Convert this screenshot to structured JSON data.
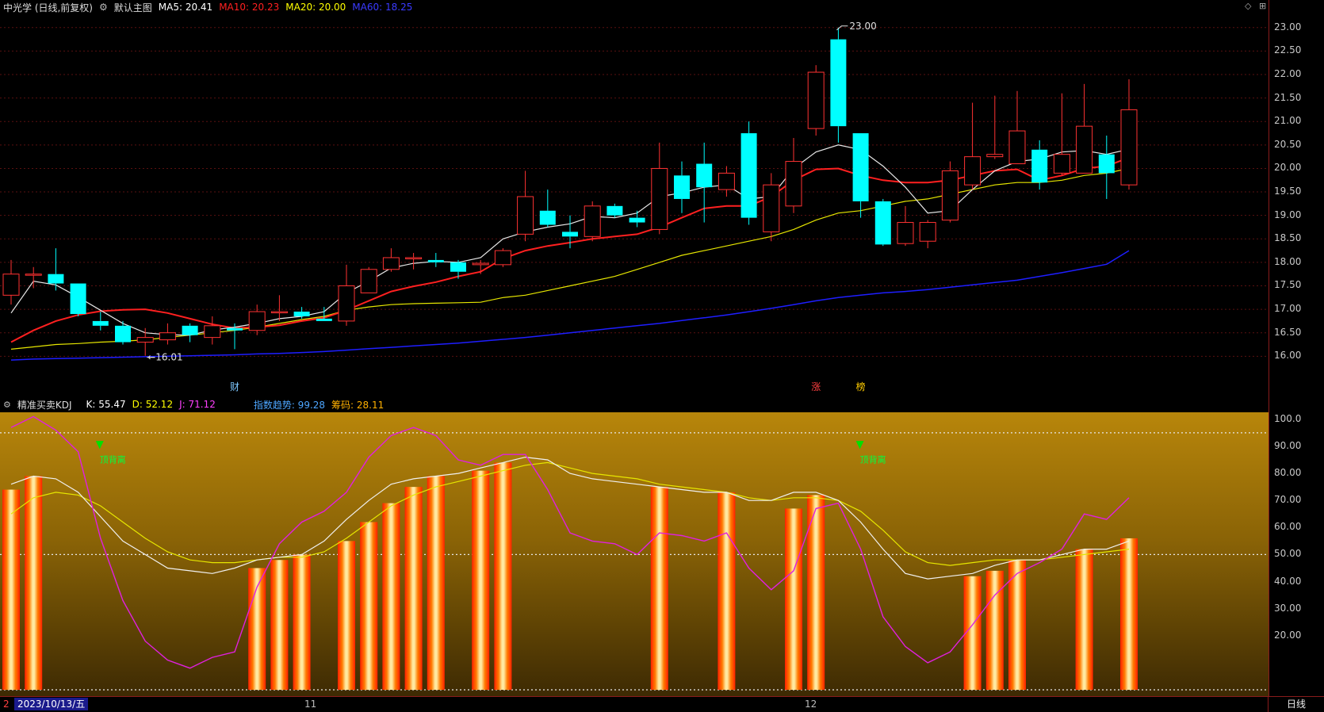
{
  "header": {
    "stock_title": "中光学 (日线,前复权)",
    "chart_name": "默认主图",
    "ma5": "MA5: 20.41",
    "ma10": "MA10: 20.23",
    "ma20": "MA20: 20.00",
    "ma60": "MA60: 18.25",
    "colors": {
      "ma5": "#ffffff",
      "ma10": "#ff2020",
      "ma20": "#ffff00",
      "ma60": "#1e1eff"
    }
  },
  "indicator_header": {
    "name": "精准买卖KDJ",
    "k": "K: 55.47",
    "d": "D: 52.12",
    "j": "J: 71.12",
    "trend": "指数趋势: 99.28",
    "chips": "筹码: 28.11"
  },
  "price_axis": [
    "23.00",
    "22.50",
    "22.00",
    "21.50",
    "21.00",
    "20.50",
    "20.00",
    "19.50",
    "19.00",
    "18.50",
    "18.00",
    "17.50",
    "17.00",
    "16.50",
    "16.00"
  ],
  "indicator_axis": [
    "100.0",
    "90.00",
    "80.00",
    "70.00",
    "60.00",
    "50.00",
    "40.00",
    "30.00",
    "20.00"
  ],
  "annotations": {
    "high_label": "23.00",
    "low_label": "16.01",
    "event_cai": "财",
    "event_zhang": "涨",
    "event_bang": "榜",
    "signal_1": "顶背离",
    "signal_2": "顶背离"
  },
  "bottom": {
    "date": "2023/10/13/五",
    "month_11": "11",
    "month_12": "12",
    "timeframe": "日线",
    "left_mark": "2"
  },
  "chart_data": {
    "type": "candlestick",
    "price_range": [
      15.6,
      23.25
    ],
    "candles": [
      {
        "o": 17.3,
        "h": 18.05,
        "l": 17.1,
        "c": 17.75
      },
      {
        "o": 17.75,
        "h": 17.9,
        "l": 17.45,
        "c": 17.75
      },
      {
        "o": 17.75,
        "h": 18.3,
        "l": 17.4,
        "c": 17.55
      },
      {
        "o": 17.55,
        "h": 17.55,
        "l": 16.85,
        "c": 16.9
      },
      {
        "o": 16.75,
        "h": 16.95,
        "l": 16.55,
        "c": 16.65
      },
      {
        "o": 16.65,
        "h": 16.75,
        "l": 16.25,
        "c": 16.3
      },
      {
        "o": 16.3,
        "h": 16.6,
        "l": 16.01,
        "c": 16.4
      },
      {
        "o": 16.35,
        "h": 16.7,
        "l": 16.25,
        "c": 16.5
      },
      {
        "o": 16.65,
        "h": 16.7,
        "l": 16.3,
        "c": 16.45
      },
      {
        "o": 16.4,
        "h": 16.85,
        "l": 16.25,
        "c": 16.65
      },
      {
        "o": 16.6,
        "h": 16.7,
        "l": 16.15,
        "c": 16.55
      },
      {
        "o": 16.55,
        "h": 17.1,
        "l": 16.45,
        "c": 16.95
      },
      {
        "o": 16.95,
        "h": 17.3,
        "l": 16.75,
        "c": 16.95
      },
      {
        "o": 16.95,
        "h": 17.05,
        "l": 16.8,
        "c": 16.85
      },
      {
        "o": 16.8,
        "h": 17.05,
        "l": 16.75,
        "c": 16.75
      },
      {
        "o": 16.75,
        "h": 17.95,
        "l": 16.65,
        "c": 17.5
      },
      {
        "o": 17.35,
        "h": 17.9,
        "l": 17.35,
        "c": 17.85
      },
      {
        "o": 17.85,
        "h": 18.3,
        "l": 17.8,
        "c": 18.1
      },
      {
        "o": 18.1,
        "h": 18.2,
        "l": 17.85,
        "c": 18.1
      },
      {
        "o": 18.05,
        "h": 18.2,
        "l": 17.9,
        "c": 18.0
      },
      {
        "o": 18.0,
        "h": 18.05,
        "l": 17.65,
        "c": 17.8
      },
      {
        "o": 17.95,
        "h": 18.05,
        "l": 17.75,
        "c": 17.98
      },
      {
        "o": 17.95,
        "h": 18.3,
        "l": 17.9,
        "c": 18.25
      },
      {
        "o": 18.6,
        "h": 19.95,
        "l": 18.45,
        "c": 19.4
      },
      {
        "o": 19.1,
        "h": 19.55,
        "l": 18.75,
        "c": 18.8
      },
      {
        "o": 18.65,
        "h": 19.0,
        "l": 18.3,
        "c": 18.55
      },
      {
        "o": 18.55,
        "h": 19.3,
        "l": 18.45,
        "c": 19.2
      },
      {
        "o": 19.2,
        "h": 19.25,
        "l": 18.95,
        "c": 19.0
      },
      {
        "o": 18.95,
        "h": 19.1,
        "l": 18.75,
        "c": 18.85
      },
      {
        "o": 18.7,
        "h": 20.55,
        "l": 18.6,
        "c": 20.0
      },
      {
        "o": 19.85,
        "h": 20.15,
        "l": 19.05,
        "c": 19.35
      },
      {
        "o": 20.1,
        "h": 20.55,
        "l": 18.85,
        "c": 19.6
      },
      {
        "o": 19.55,
        "h": 20.05,
        "l": 19.4,
        "c": 19.9
      },
      {
        "o": 20.75,
        "h": 21.0,
        "l": 18.8,
        "c": 18.95
      },
      {
        "o": 18.65,
        "h": 19.9,
        "l": 18.45,
        "c": 19.65
      },
      {
        "o": 19.2,
        "h": 20.65,
        "l": 19.05,
        "c": 20.15
      },
      {
        "o": 20.85,
        "h": 22.2,
        "l": 20.7,
        "c": 22.05
      },
      {
        "o": 22.75,
        "h": 23.0,
        "l": 20.55,
        "c": 20.9
      },
      {
        "o": 20.75,
        "h": 20.75,
        "l": 18.95,
        "c": 19.3
      },
      {
        "o": 19.3,
        "h": 19.35,
        "l": 18.35,
        "c": 18.38
      },
      {
        "o": 18.4,
        "h": 19.2,
        "l": 18.35,
        "c": 18.85
      },
      {
        "o": 18.45,
        "h": 18.9,
        "l": 18.3,
        "c": 18.85
      },
      {
        "o": 18.9,
        "h": 20.15,
        "l": 18.85,
        "c": 19.95
      },
      {
        "o": 19.65,
        "h": 21.4,
        "l": 19.55,
        "c": 20.25
      },
      {
        "o": 20.25,
        "h": 21.55,
        "l": 20.2,
        "c": 20.3
      },
      {
        "o": 20.1,
        "h": 21.65,
        "l": 20.1,
        "c": 20.8
      },
      {
        "o": 20.4,
        "h": 20.6,
        "l": 19.55,
        "c": 19.7
      },
      {
        "o": 19.9,
        "h": 21.6,
        "l": 19.85,
        "c": 20.3
      },
      {
        "o": 19.9,
        "h": 21.8,
        "l": 19.9,
        "c": 20.9
      },
      {
        "o": 20.3,
        "h": 20.7,
        "l": 19.35,
        "c": 19.9
      },
      {
        "o": 19.65,
        "h": 21.9,
        "l": 19.55,
        "c": 21.25
      }
    ],
    "ma5": [
      16.92,
      17.6,
      17.52,
      17.26,
      16.98,
      16.7,
      16.5,
      16.46,
      16.45,
      16.56,
      16.62,
      16.7,
      16.8,
      16.85,
      16.95,
      17.35,
      17.6,
      17.88,
      17.98,
      18.02,
      18.0,
      18.1,
      18.5,
      18.65,
      18.75,
      18.82,
      18.98,
      18.95,
      19.05,
      19.4,
      19.48,
      19.6,
      19.65,
      19.35,
      19.4,
      20.0,
      20.35,
      20.5,
      20.4,
      20.05,
      19.6,
      19.05,
      19.1,
      19.55,
      19.95,
      20.15,
      20.2,
      20.35,
      20.38,
      20.3,
      20.41
    ],
    "ma10": [
      16.3,
      16.55,
      16.75,
      16.88,
      16.96,
      16.99,
      17.0,
      16.92,
      16.8,
      16.68,
      16.6,
      16.62,
      16.66,
      16.75,
      16.82,
      16.98,
      17.18,
      17.38,
      17.49,
      17.58,
      17.7,
      17.8,
      18.08,
      18.25,
      18.35,
      18.42,
      18.5,
      18.55,
      18.6,
      18.75,
      18.95,
      19.15,
      19.2,
      19.2,
      19.4,
      19.75,
      19.98,
      20.0,
      19.85,
      19.75,
      19.7,
      19.7,
      19.75,
      19.85,
      19.95,
      19.98,
      19.75,
      19.85,
      20.0,
      20.05,
      20.23
    ],
    "ma20": [
      16.15,
      16.2,
      16.25,
      16.27,
      16.3,
      16.32,
      16.35,
      16.4,
      16.45,
      16.5,
      16.55,
      16.62,
      16.7,
      16.78,
      16.85,
      16.98,
      17.05,
      17.1,
      17.12,
      17.13,
      17.14,
      17.15,
      17.25,
      17.3,
      17.4,
      17.5,
      17.6,
      17.7,
      17.85,
      18.0,
      18.15,
      18.25,
      18.35,
      18.45,
      18.55,
      18.7,
      18.9,
      19.05,
      19.1,
      19.2,
      19.3,
      19.35,
      19.45,
      19.55,
      19.65,
      19.7,
      19.7,
      19.75,
      19.85,
      19.9,
      20.0
    ],
    "ma60": [
      15.92,
      15.94,
      15.95,
      15.96,
      15.97,
      15.98,
      15.99,
      16.0,
      16.01,
      16.02,
      16.03,
      16.05,
      16.06,
      16.08,
      16.1,
      16.13,
      16.16,
      16.19,
      16.22,
      16.25,
      16.28,
      16.32,
      16.36,
      16.4,
      16.45,
      16.5,
      16.55,
      16.6,
      16.65,
      16.7,
      16.76,
      16.82,
      16.88,
      16.95,
      17.02,
      17.1,
      17.18,
      17.25,
      17.3,
      17.35,
      17.38,
      17.42,
      17.47,
      17.52,
      17.57,
      17.62,
      17.7,
      17.78,
      17.87,
      17.96,
      18.25
    ],
    "kdj_range": [
      0,
      102
    ],
    "kdj_ref_lines": [
      95,
      50,
      0
    ],
    "k": [
      76,
      79,
      78,
      73,
      64,
      55,
      50,
      45,
      44,
      43,
      45,
      48,
      49,
      50,
      55,
      63,
      70,
      76,
      78,
      79,
      80,
      82,
      84,
      86,
      85,
      80,
      78,
      77,
      76,
      75,
      74,
      73,
      73,
      70,
      70,
      73,
      73,
      70,
      62,
      52,
      43,
      41,
      42,
      43,
      46,
      48,
      48,
      50,
      52,
      52,
      55
    ],
    "d": [
      65,
      71,
      73,
      72,
      68,
      62,
      56,
      51,
      48,
      47,
      47,
      48,
      49,
      49,
      51,
      56,
      62,
      68,
      72,
      75,
      77,
      79,
      81,
      83,
      84,
      82,
      80,
      79,
      78,
      76,
      75,
      74,
      73,
      71,
      70,
      71,
      71,
      70,
      66,
      59,
      51,
      47,
      46,
      47,
      48,
      48,
      48,
      49,
      50,
      51,
      52
    ],
    "j": [
      97,
      101,
      96,
      88,
      56,
      33,
      18,
      11,
      8,
      12,
      14,
      38,
      54,
      62,
      66,
      73,
      86,
      94,
      97,
      94,
      85,
      83,
      87,
      87,
      74,
      58,
      55,
      54,
      50,
      58,
      57,
      55,
      58,
      45,
      37,
      44,
      67,
      69,
      52,
      27,
      16,
      10,
      14,
      24,
      35,
      43,
      47,
      52,
      65,
      63,
      71
    ],
    "bars": [
      {
        "i": 0,
        "v": 74
      },
      {
        "i": 1,
        "v": 79
      },
      {
        "i": 11,
        "v": 45
      },
      {
        "i": 12,
        "v": 48
      },
      {
        "i": 13,
        "v": 50
      },
      {
        "i": 15,
        "v": 55
      },
      {
        "i": 16,
        "v": 62
      },
      {
        "i": 17,
        "v": 69
      },
      {
        "i": 18,
        "v": 75
      },
      {
        "i": 19,
        "v": 79
      },
      {
        "i": 21,
        "v": 81
      },
      {
        "i": 22,
        "v": 84
      },
      {
        "i": 29,
        "v": 75
      },
      {
        "i": 32,
        "v": 73
      },
      {
        "i": 35,
        "v": 67
      },
      {
        "i": 36,
        "v": 72
      },
      {
        "i": 43,
        "v": 42
      },
      {
        "i": 44,
        "v": 44
      },
      {
        "i": 45,
        "v": 48
      },
      {
        "i": 48,
        "v": 52
      },
      {
        "i": 50,
        "v": 56
      }
    ]
  }
}
